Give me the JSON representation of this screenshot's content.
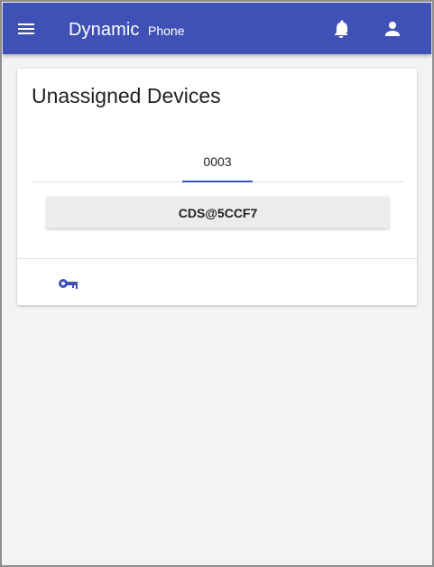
{
  "appbar": {
    "title": "Dynamic",
    "subtitle": "Phone",
    "background_color": "#3f51b5",
    "icons": {
      "menu": "menu-icon",
      "notifications": "bell-icon",
      "account": "person-icon"
    }
  },
  "card": {
    "title": "Unassigned Devices",
    "tabs": [
      {
        "label": "0003",
        "active": true
      }
    ],
    "device_button_label": "CDS@5CCF7",
    "actions": {
      "key_icon": "key-icon"
    }
  },
  "colors": {
    "primary": "#3f51b5",
    "background": "#f3f3f3",
    "card": "#ffffff"
  }
}
